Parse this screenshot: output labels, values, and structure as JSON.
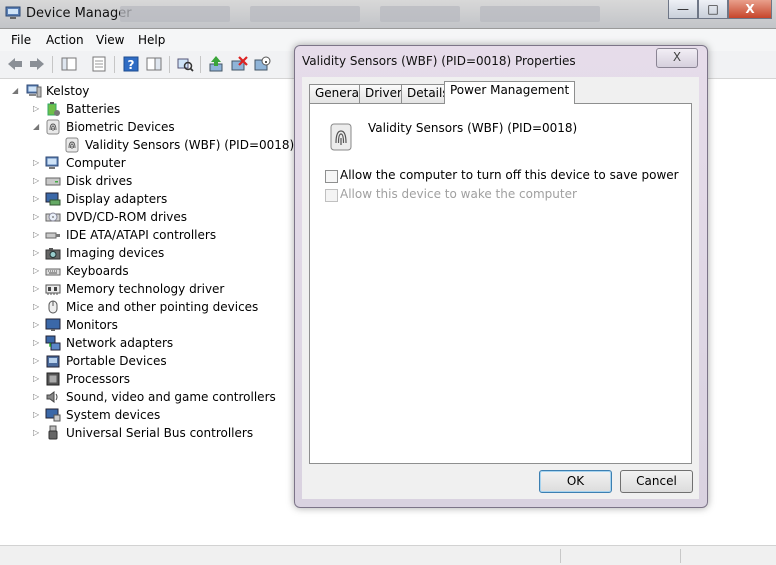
{
  "window": {
    "title": "Device Manager",
    "controls": {
      "minimize": "—",
      "maximize": "□",
      "close": "X"
    }
  },
  "menu": [
    "File",
    "Action",
    "View",
    "Help"
  ],
  "tree": {
    "root": "Kelstoy",
    "items": [
      {
        "label": "Batteries",
        "icon": "battery-icon",
        "expanded": false
      },
      {
        "label": "Biometric Devices",
        "icon": "fingerprint-icon",
        "expanded": true
      },
      {
        "label": "Validity Sensors (WBF) (PID=0018)",
        "icon": "fingerprint-sensor-icon",
        "child": true
      },
      {
        "label": "Computer",
        "icon": "computer-icon",
        "expanded": false
      },
      {
        "label": "Disk drives",
        "icon": "disk-drive-icon",
        "expanded": false
      },
      {
        "label": "Display adapters",
        "icon": "display-adapter-icon",
        "expanded": false
      },
      {
        "label": "DVD/CD-ROM drives",
        "icon": "dvd-drive-icon",
        "expanded": false
      },
      {
        "label": "IDE ATA/ATAPI controllers",
        "icon": "ide-controller-icon",
        "expanded": false
      },
      {
        "label": "Imaging devices",
        "icon": "camera-icon",
        "expanded": false
      },
      {
        "label": "Keyboards",
        "icon": "keyboard-icon",
        "expanded": false
      },
      {
        "label": "Memory technology driver",
        "icon": "memory-icon",
        "expanded": false
      },
      {
        "label": "Mice and other pointing devices",
        "icon": "mouse-icon",
        "expanded": false
      },
      {
        "label": "Monitors",
        "icon": "monitor-icon",
        "expanded": false
      },
      {
        "label": "Network adapters",
        "icon": "network-icon",
        "expanded": false
      },
      {
        "label": "Portable Devices",
        "icon": "portable-device-icon",
        "expanded": false
      },
      {
        "label": "Processors",
        "icon": "processor-icon",
        "expanded": false
      },
      {
        "label": "Sound, video and game controllers",
        "icon": "speaker-icon",
        "expanded": false
      },
      {
        "label": "System devices",
        "icon": "system-devices-icon",
        "expanded": false
      },
      {
        "label": "Universal Serial Bus controllers",
        "icon": "usb-icon",
        "expanded": false
      }
    ]
  },
  "dialog": {
    "title": "Validity Sensors (WBF) (PID=0018) Properties",
    "close": "X",
    "tabs": [
      "General",
      "Driver",
      "Details",
      "Power Management"
    ],
    "active_tab": "Power Management",
    "device_name": "Validity Sensors (WBF) (PID=0018)",
    "options": [
      {
        "label": "Allow the computer to turn off this device to save power",
        "checked": false,
        "enabled": true
      },
      {
        "label": "Allow this device to wake the computer",
        "checked": false,
        "enabled": false
      }
    ],
    "ok": "OK",
    "cancel": "Cancel"
  },
  "colors": {
    "dialog_frame": "#e6dcea",
    "title_bar": "#c2c4c8",
    "close_button": "#c6452b",
    "ok_focus": "#3c7fb1"
  }
}
